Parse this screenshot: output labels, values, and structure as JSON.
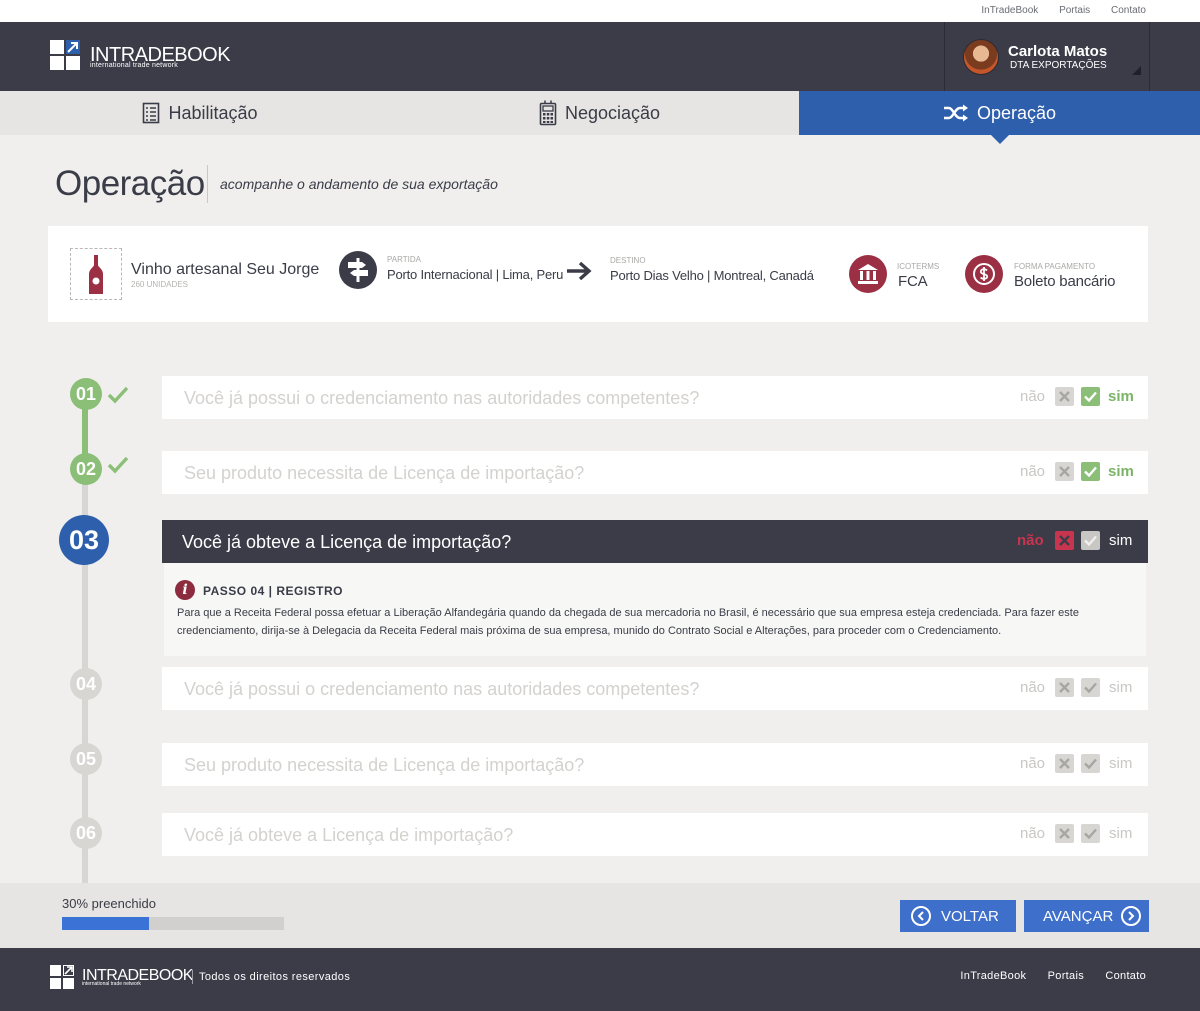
{
  "util_links": [
    "InTradeBook",
    "Portais",
    "Contato"
  ],
  "brand": {
    "name": "INTRADEBOOK",
    "tagline": "international trade network"
  },
  "user": {
    "name": "Carlota Matos",
    "role": "DTA EXPORTAÇÕES"
  },
  "nav": {
    "tabs": [
      {
        "label": "Habilitação",
        "icon": "document-list-icon",
        "active": false
      },
      {
        "label": "Negociação",
        "icon": "calculator-icon",
        "active": false
      },
      {
        "label": "Operação",
        "icon": "shuffle-icon",
        "active": true
      }
    ]
  },
  "page": {
    "title": "Operação",
    "subtitle": "acompanhe o andamento de sua exportação"
  },
  "shipment": {
    "product_name": "Vinho artesanal Seu Jorge",
    "product_qty": "260 UNIDADES",
    "origin_label": "PARTIDA",
    "origin_value": "Porto Internacional | Lima, Peru",
    "destination_label": "DESTINO",
    "destination_value": "Porto Dias Velho | Montreal, Canadá",
    "incoterms_label": "ICOTERMS",
    "incoterms_value": "FCA",
    "payment_label": "FORMA PAGAMENTO",
    "payment_value": "Boleto bancário"
  },
  "answer_labels": {
    "no": "não",
    "yes": "sim"
  },
  "steps": [
    {
      "number": "01",
      "question": "Você já possui o credenciamento nas autoridades competentes?",
      "state": "done",
      "answer": "sim"
    },
    {
      "number": "02",
      "question": "Seu produto necessita de Licença de importação?",
      "state": "done",
      "answer": "sim"
    },
    {
      "number": "03",
      "question": "Você já obteve a Licença de importação?",
      "state": "current",
      "answer": "não"
    },
    {
      "number": "04",
      "question": "Você já possui o credenciamento nas autoridades competentes?",
      "state": "future",
      "answer": null
    },
    {
      "number": "05",
      "question": "Seu produto necessita de Licença de importação?",
      "state": "future",
      "answer": null
    },
    {
      "number": "06",
      "question": "Você já obteve a Licença de importação?",
      "state": "future",
      "answer": null
    }
  ],
  "detail": {
    "title": "PASSO 04 | REGISTRO",
    "text": "Para que a Receita Federal possa efetuar a Liberação Alfandegária quando da chegada de sua mercadoria no Brasil, é necessário que sua empresa esteja credenciada. Para fazer este credenciamento, dirija-se à Delegacia da Receita Federal mais próxima de sua empresa, munido do Contrato Social e Alterações, para proceder com o Credenciamento."
  },
  "progress": {
    "label": "30% preenchido",
    "fraction": 0.39
  },
  "buttons": {
    "back": "VOLTAR",
    "next": "AVANÇAR"
  },
  "footer": {
    "rights": "Todos os direitos reservados",
    "links": [
      "InTradeBook",
      "Portais",
      "Contato"
    ]
  },
  "colors": {
    "accent": "#2e5fac",
    "done": "#8bbf77",
    "danger": "#c9344f",
    "header": "#3b3c48",
    "wine": "#9b2f43"
  }
}
